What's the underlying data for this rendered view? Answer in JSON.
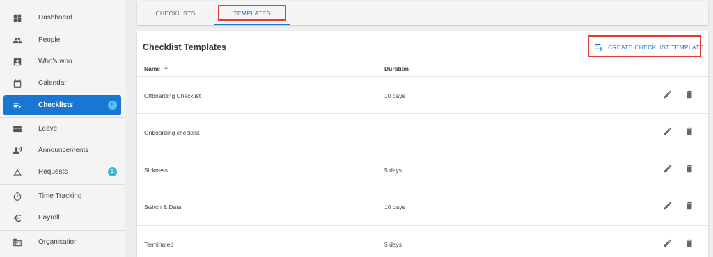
{
  "sidebar": {
    "items": [
      {
        "label": "Dashboard",
        "icon": "dashboard-icon"
      },
      {
        "label": "People",
        "icon": "people-icon"
      },
      {
        "label": "Who's who",
        "icon": "contact-badge-icon"
      },
      {
        "label": "Calendar",
        "icon": "calendar-icon"
      },
      {
        "label": "Checklists",
        "icon": "checklist-icon",
        "badge": "5",
        "active": true
      },
      {
        "label": "Leave",
        "icon": "leave-icon"
      },
      {
        "label": "Announcements",
        "icon": "announcement-icon"
      },
      {
        "label": "Requests",
        "icon": "triangle-icon",
        "badge": "2"
      },
      {
        "label": "Time Tracking",
        "icon": "stopwatch-icon"
      },
      {
        "label": "Payroll",
        "icon": "euro-icon"
      },
      {
        "label": "Organisation",
        "icon": "building-icon"
      }
    ]
  },
  "tabs": [
    {
      "label": "CHECKLISTS",
      "active": false
    },
    {
      "label": "TEMPLATES",
      "active": true
    }
  ],
  "main": {
    "title": "Checklist Templates",
    "create_label": "CREATE CHECKLIST TEMPLATE",
    "columns": {
      "name": "Name",
      "duration": "Duration"
    },
    "rows": [
      {
        "name": "Offboarding Checklist",
        "duration": "10 days"
      },
      {
        "name": "Onboarding checklist",
        "duration": ""
      },
      {
        "name": "Sickness",
        "duration": "5 days"
      },
      {
        "name": "Switch & Data",
        "duration": "10 days"
      },
      {
        "name": "Terminated",
        "duration": "5 days"
      }
    ]
  },
  "colors": {
    "accent": "#1976d2",
    "highlight": "#e53935",
    "badge": "#39b6d6"
  }
}
